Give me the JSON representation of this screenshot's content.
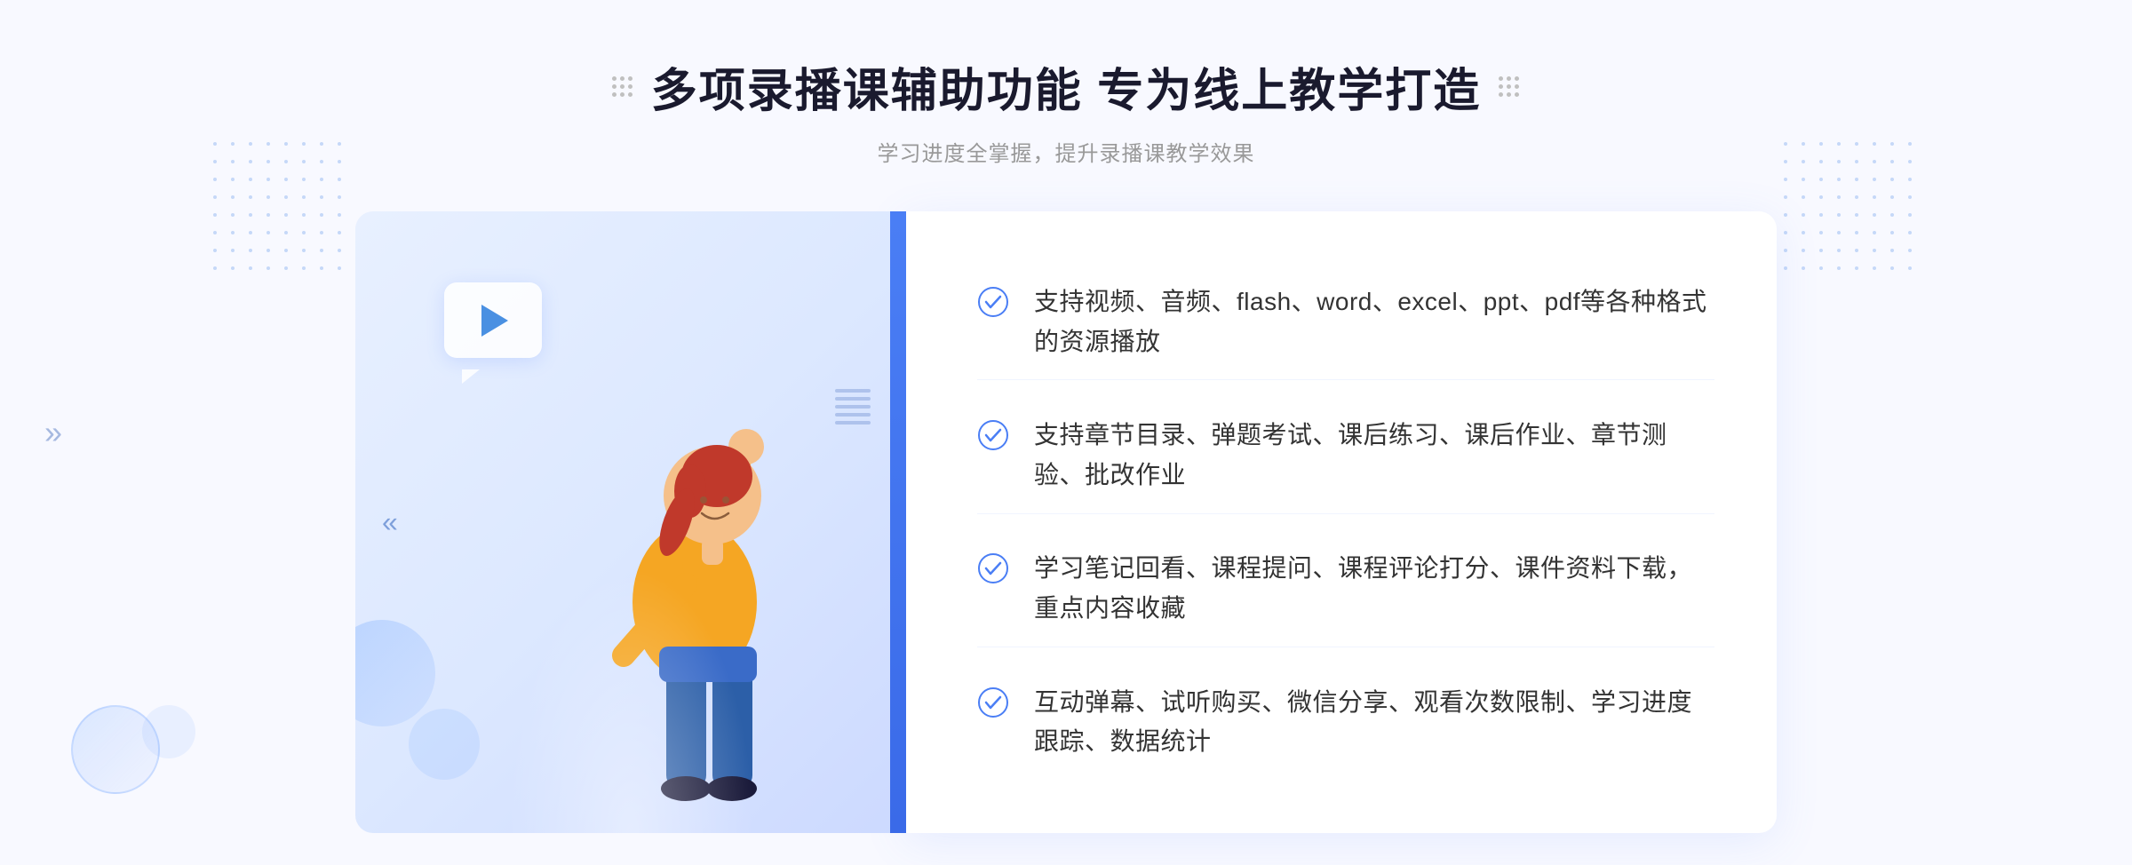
{
  "page": {
    "background": "#f8f9ff"
  },
  "header": {
    "title": "多项录播课辅助功能 专为线上教学打造",
    "subtitle": "学习进度全掌握，提升录播课教学效果",
    "decoration_left": "❖",
    "decoration_right": "❖"
  },
  "features": [
    {
      "id": 1,
      "text": "支持视频、音频、flash、word、excel、ppt、pdf等各种格式的资源播放"
    },
    {
      "id": 2,
      "text": "支持章节目录、弹题考试、课后练习、课后作业、章节测验、批改作业"
    },
    {
      "id": 3,
      "text": "学习笔记回看、课程提问、课程评论打分、课件资料下载，重点内容收藏"
    },
    {
      "id": 4,
      "text": "互动弹幕、试听购买、微信分享、观看次数限制、学习进度跟踪、数据统计"
    }
  ],
  "illustration": {
    "play_icon": "▶",
    "arrow_left": "»"
  }
}
